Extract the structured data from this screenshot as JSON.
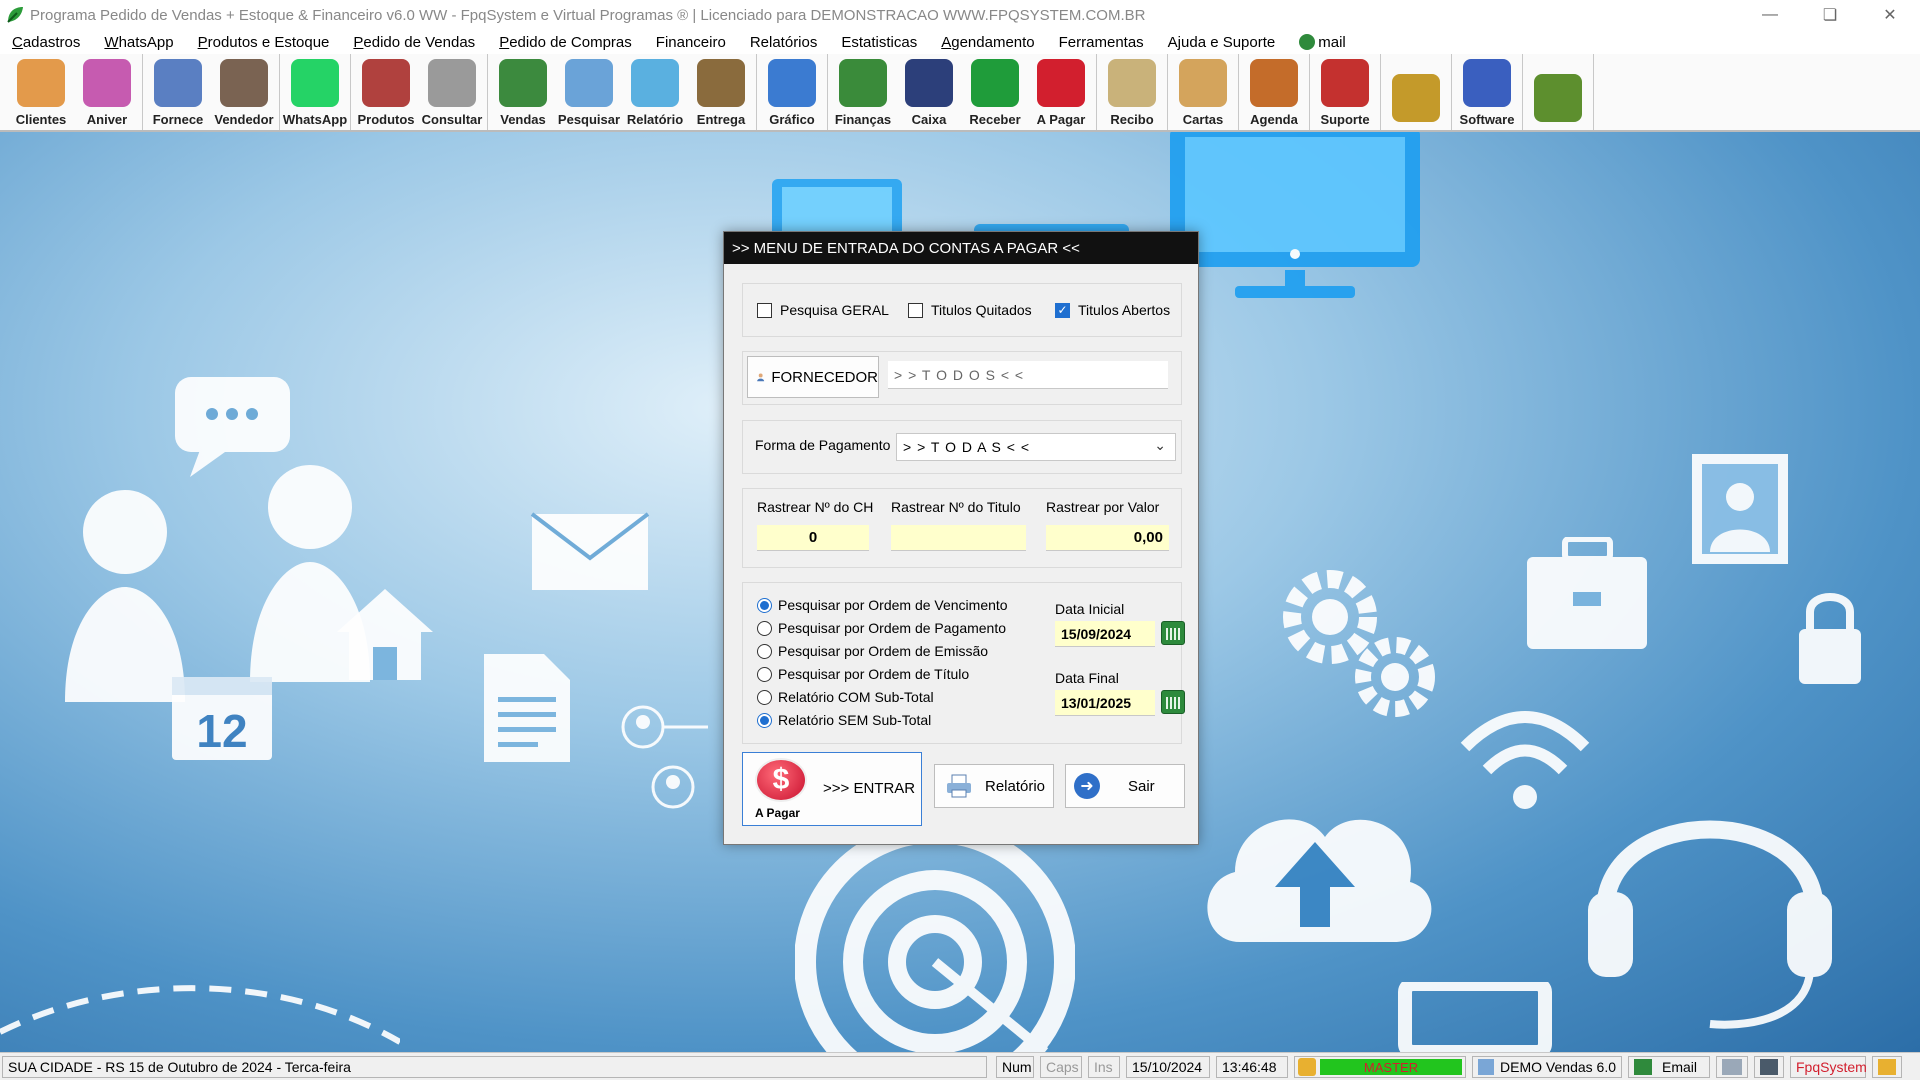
{
  "window": {
    "title": "Programa Pedido de Vendas + Estoque & Financeiro v6.0 WW - FpqSystem e Virtual Programas ® | Licenciado para  DEMONSTRACAO WWW.FPQSYSTEM.COM.BR"
  },
  "menu": [
    {
      "label": "Cadastros",
      "accel": "C",
      "rest": "adastros"
    },
    {
      "label": "WhatsApp",
      "accel": "W",
      "rest": "hatsApp"
    },
    {
      "label": "Produtos e Estoque",
      "accel": "P",
      "rest": "rodutos e Estoque"
    },
    {
      "label": "Pedido de Vendas",
      "accel": "P",
      "rest": "edido de Vendas"
    },
    {
      "label": "Pedido de Compras",
      "accel": "P",
      "rest": "edido de Compras"
    },
    {
      "label": "Financeiro",
      "accel": "",
      "rest": "Financeiro"
    },
    {
      "label": "Relatórios",
      "accel": "",
      "rest": "Relatórios"
    },
    {
      "label": "Estatisticas",
      "accel": "",
      "rest": "Estatisticas"
    },
    {
      "label": "Agendamento",
      "accel": "A",
      "rest": "gendamento"
    },
    {
      "label": "Ferramentas",
      "accel": "",
      "rest": "Ferramentas"
    },
    {
      "label": "Ajuda e Suporte",
      "accel": "",
      "rest": "Ajuda e Suporte"
    },
    {
      "label": "mail",
      "accel": "",
      "rest": "mail"
    }
  ],
  "toolbar": {
    "groups": [
      [
        {
          "label": "Clientes",
          "icon": "clients-icon",
          "color": "#e39a4b"
        },
        {
          "label": "Aniver",
          "icon": "birthday-cake-icon",
          "color": "#c65bb0"
        }
      ],
      [
        {
          "label": "Fornece",
          "icon": "supplier-icon",
          "color": "#5a7fc2"
        },
        {
          "label": "Vendedor",
          "icon": "salesperson-icon",
          "color": "#7a6352"
        }
      ],
      [
        {
          "label": "WhatsApp",
          "icon": "whatsapp-icon",
          "color": "#25d366"
        }
      ],
      [
        {
          "label": "Produtos",
          "icon": "products-icon",
          "color": "#b0413e"
        },
        {
          "label": "Consultar",
          "icon": "barcode-icon",
          "color": "#9a9a9a"
        }
      ],
      [
        {
          "label": "Vendas",
          "icon": "shopping-cart-icon",
          "color": "#3c8a3e"
        },
        {
          "label": "Pesquisar",
          "icon": "magnifier-icon",
          "color": "#6aa3d8"
        },
        {
          "label": "Relatório",
          "icon": "printer-icon",
          "color": "#5ab0e0"
        },
        {
          "label": "Entrega",
          "icon": "hand-truck-icon",
          "color": "#8a6b3d"
        }
      ],
      [
        {
          "label": "Gráfico",
          "icon": "bar-chart-icon",
          "color": "#3b7bd1"
        }
      ],
      [
        {
          "label": "Finanças",
          "icon": "finance-globe-icon",
          "color": "#3a8b3a"
        },
        {
          "label": "Caixa",
          "icon": "cash-book-icon",
          "color": "#2c3f7a"
        },
        {
          "label": "Receber",
          "icon": "dollar-green-icon",
          "color": "#1f9c3a"
        },
        {
          "label": "A Pagar",
          "icon": "dollar-red-icon",
          "color": "#d21f2e"
        }
      ],
      [
        {
          "label": "Recibo",
          "icon": "receipt-icon",
          "color": "#c9b27a"
        }
      ],
      [
        {
          "label": "Cartas",
          "icon": "scroll-icon",
          "color": "#d4a45c"
        }
      ],
      [
        {
          "label": "Agenda",
          "icon": "clock-icon",
          "color": "#c46c2a"
        }
      ],
      [
        {
          "label": "Suporte",
          "icon": "support-icon",
          "color": "#c4312f"
        }
      ],
      [
        {
          "label": "",
          "icon": "coins-icon",
          "color": "#c49a2a"
        }
      ],
      [
        {
          "label": "Software",
          "icon": "software-icon",
          "color": "#3a5fbf"
        }
      ],
      [
        {
          "label": "",
          "icon": "exit-door-icon",
          "color": "#5d8f2e"
        }
      ]
    ]
  },
  "dialog": {
    "title": ">>  MENU DE ENTRADA DO CONTAS A PAGAR  <<",
    "checkboxes": [
      {
        "label": "Pesquisa GERAL",
        "checked": false
      },
      {
        "label": "Titulos Quitados",
        "checked": false
      },
      {
        "label": "Titulos Abertos",
        "checked": true
      }
    ],
    "fornecedor_button": "FORNECEDOR",
    "fornecedor_value": "> > T O D O S < <",
    "forma_label": "Forma de Pagamento",
    "forma_value": "> > T O D A S < <",
    "rastrear": {
      "ch_label": "Rastrear Nº do CH",
      "ch_value": "0",
      "titulo_label": "Rastrear Nº do Titulo",
      "titulo_value": "",
      "valor_label": "Rastrear por Valor",
      "valor_value": "0,00"
    },
    "radios": [
      {
        "label": "Pesquisar por Ordem de Vencimento",
        "selected": true
      },
      {
        "label": "Pesquisar por Ordem de Pagamento",
        "selected": false
      },
      {
        "label": "Pesquisar por Ordem de Emissão",
        "selected": false
      },
      {
        "label": "Pesquisar por Ordem de Título",
        "selected": false
      },
      {
        "label": "Relatório COM Sub-Total",
        "selected": false
      },
      {
        "label": "Relatório SEM Sub-Total",
        "selected": true
      }
    ],
    "data_inicial_label": "Data Inicial",
    "data_inicial": "15/09/2024",
    "data_final_label": "Data Final",
    "data_final": "13/01/2025",
    "entrar_caption": "A Pagar",
    "entrar_label": ">>> ENTRAR",
    "relatorio_label": "Relatório",
    "sair_label": "Sair"
  },
  "statusbar": {
    "city": "SUA CIDADE - RS 15 de Outubro de 2024 - Terca-feira",
    "num": "Num",
    "caps": "Caps",
    "ins": "Ins",
    "date": "15/10/2024",
    "time": "13:46:48",
    "user": "MASTER",
    "version": "DEMO Vendas 6.0",
    "email": "Email",
    "brand": "FpqSystem"
  },
  "desktop": {
    "calendar_day": "12"
  },
  "colors": {
    "accent_blue": "#1f6fd0",
    "input_yellow": "#ffffcc",
    "status_green": "#22c51e",
    "brand_red": "#d21f2e"
  }
}
